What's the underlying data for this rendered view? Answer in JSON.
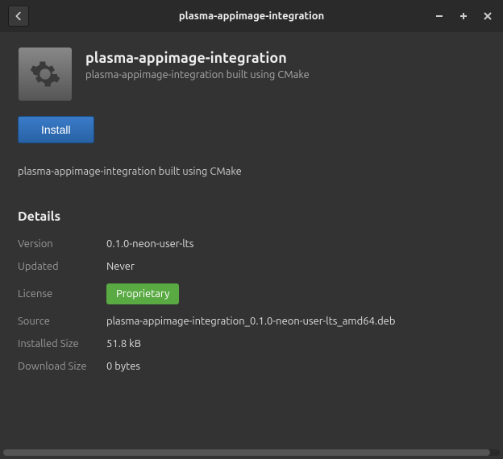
{
  "window": {
    "title": "plasma-appimage-integration"
  },
  "app": {
    "name": "plasma-appimage-integration",
    "subtitle": "plasma-appimage-integration built using CMake"
  },
  "actions": {
    "install_label": "Install"
  },
  "description": "plasma-appimage-integration built using CMake",
  "details": {
    "heading": "Details",
    "labels": {
      "version": "Version",
      "updated": "Updated",
      "license": "License",
      "source": "Source",
      "installed_size": "Installed Size",
      "download_size": "Download Size"
    },
    "values": {
      "version": "0.1.0-neon-user-lts",
      "updated": "Never",
      "license": "Proprietary",
      "source": "plasma-appimage-integration_0.1.0-neon-user-lts_amd64.deb",
      "installed_size": "51.8 kB",
      "download_size": "0 bytes"
    }
  }
}
